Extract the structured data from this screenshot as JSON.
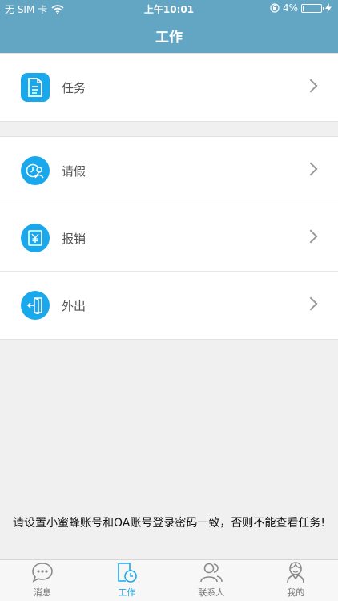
{
  "status_bar": {
    "carrier": "无 SIM 卡",
    "time": "上午10:01",
    "battery": "4%",
    "battery_level": 0.04
  },
  "header": {
    "title": "工作"
  },
  "groups": [
    {
      "items": [
        {
          "label": "任务",
          "icon": "task-document-icon"
        }
      ]
    },
    {
      "items": [
        {
          "label": "请假",
          "icon": "leave-clock-user-icon"
        },
        {
          "label": "报销",
          "icon": "reimburse-yen-icon"
        },
        {
          "label": "外出",
          "icon": "go-out-door-icon"
        }
      ]
    }
  ],
  "notice": "请设置小蜜蜂账号和OA账号登录密码一致，否则不能查看任务!",
  "tabbar": {
    "tabs": [
      {
        "label": "消息",
        "icon": "chat-bubble-icon",
        "active": false
      },
      {
        "label": "工作",
        "icon": "work-clock-icon",
        "active": true
      },
      {
        "label": "联系人",
        "icon": "contacts-icon",
        "active": false
      },
      {
        "label": "我的",
        "icon": "profile-icon",
        "active": false
      }
    ]
  },
  "colors": {
    "header": "#63a6c4",
    "accent": "#1aa8ec",
    "background": "#f0f0f0"
  }
}
